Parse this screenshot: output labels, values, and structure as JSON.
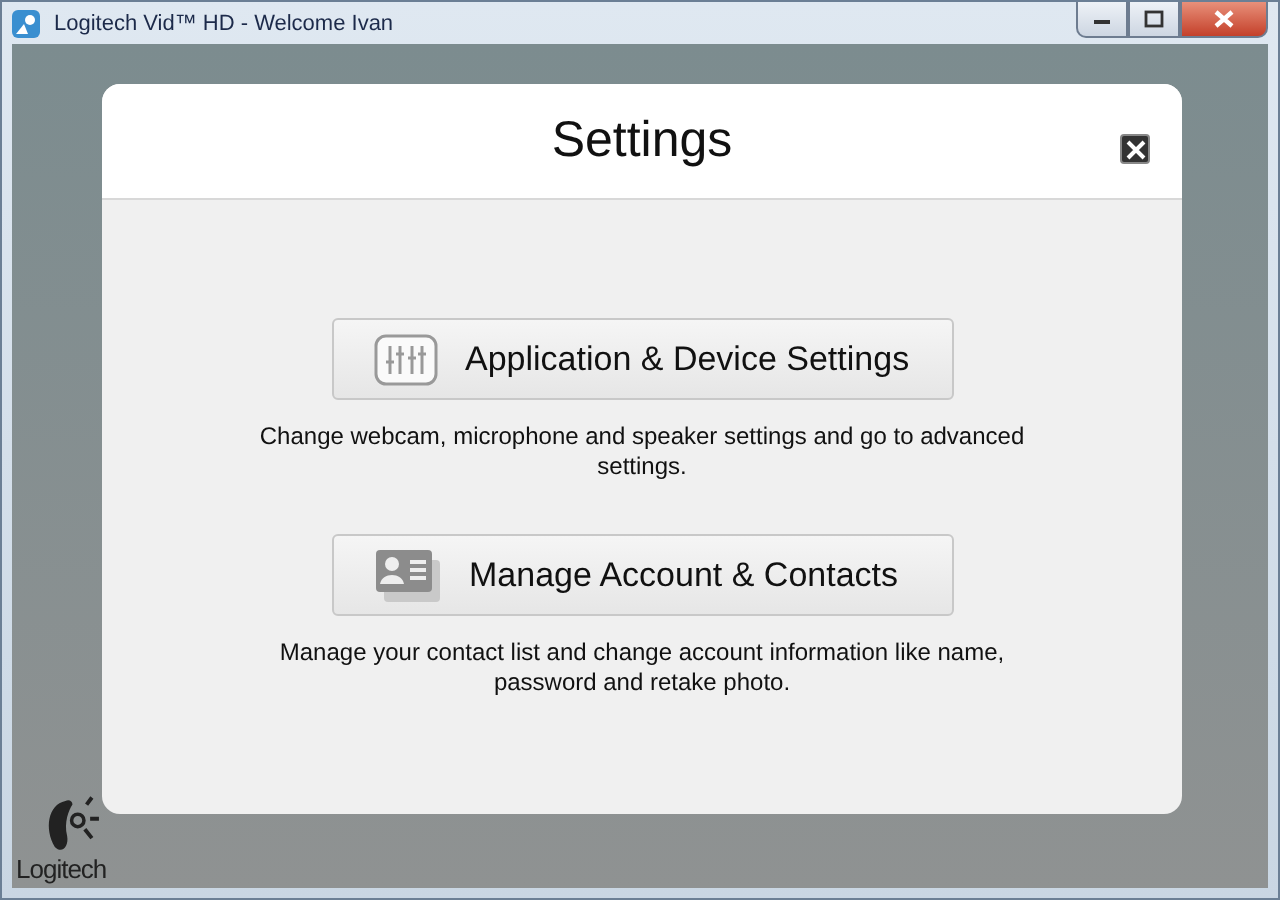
{
  "window": {
    "title": "Logitech Vid™ HD - Welcome Ivan"
  },
  "dialog": {
    "title": "Settings",
    "options": [
      {
        "kind": "device",
        "label": "Application & Device Settings",
        "description": "Change webcam, microphone and speaker settings and go to advanced settings."
      },
      {
        "kind": "account",
        "label": "Manage Account & Contacts",
        "description": "Manage your contact list and change account information like name, password and retake photo."
      }
    ]
  },
  "brand": {
    "name": "Logitech"
  }
}
